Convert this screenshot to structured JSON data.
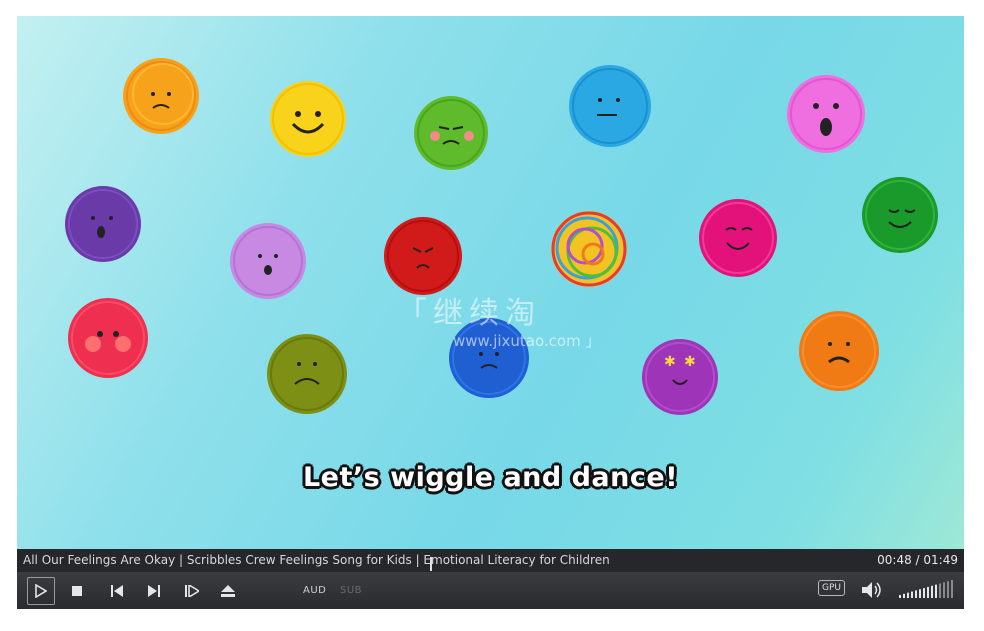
{
  "video": {
    "subtitle": "Let’s wiggle and dance!",
    "watermark_cn": "继续淘",
    "watermark_url": "www.jixutao.com",
    "bracket_open": "「",
    "bracket_close": "」"
  },
  "infobar": {
    "title": "All Our Feelings Are Okay | Scribbles Crew Feelings Song for Kids | Emotional Literacy for Children",
    "time": "00:48 / 01:49"
  },
  "controls": {
    "aud_label": "AUD",
    "sub_label": "SUB",
    "gpu_label": "GPU",
    "volume_level": 0.7
  },
  "colors": {
    "bg_top": "#c3f0f1",
    "bg_mid": "#77d8e8",
    "bar": "#25272b"
  }
}
